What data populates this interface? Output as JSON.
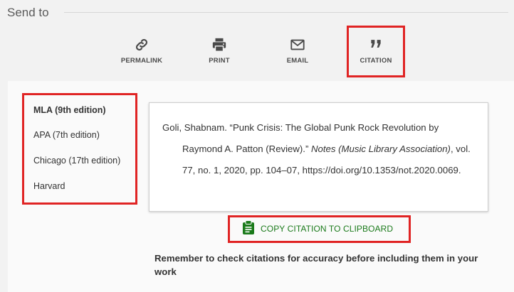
{
  "header": {
    "title": "Send to"
  },
  "actions": [
    {
      "label": "PERMALINK",
      "icon": "link-icon"
    },
    {
      "label": "PRINT",
      "icon": "printer-icon"
    },
    {
      "label": "EMAIL",
      "icon": "envelope-icon"
    },
    {
      "label": "CITATION",
      "icon": "quote-icon"
    }
  ],
  "citation_styles": [
    {
      "label": "MLA (9th edition)",
      "selected": true
    },
    {
      "label": "APA (7th edition)",
      "selected": false
    },
    {
      "label": "Chicago (17th edition)",
      "selected": false
    },
    {
      "label": "Harvard",
      "selected": false
    }
  ],
  "citation": {
    "part1": "Goli, Shabnam. “Punk Crisis: The Global Punk Rock Revolution by Raymond A. Patton (Review).” ",
    "journal": "Notes (Music Library Association)",
    "part2": ", vol. 77, no. 1, 2020, pp. 104–07, https://doi.org/10.1353/not.2020.0069."
  },
  "copy_button": {
    "label": "COPY CITATION TO CLIPBOARD",
    "icon": "clipboard-icon"
  },
  "reminder": "Remember to check citations for accuracy before including them in your work",
  "colors": {
    "highlight": "#e02424",
    "copy_green": "#1a7a1a",
    "panel_bg": "#fafafa",
    "page_bg": "#f2f2f2"
  }
}
